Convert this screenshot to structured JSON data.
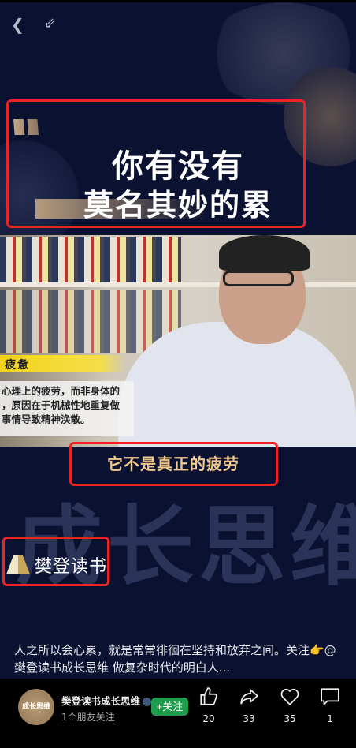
{
  "title_card": {
    "line1": "你有没有",
    "line2": "莫名其妙的累"
  },
  "video": {
    "banner": "疲惫",
    "info_lines": [
      "心理上的疲劳，而非身体的",
      "，原因在于机械性地重复做",
      "事情导致精神涣散。"
    ],
    "subtitle": "它不是真正的疲劳",
    "watermark": "成长思维",
    "logo_text": "樊登读书"
  },
  "caption": "人之所以会心累，就是常常徘徊在坚持和放弃之间。关注👉@樊登读书成长思维 做复杂时代的明白人...",
  "author": {
    "name": "樊登读书成长思维",
    "avatar_text": "成长思维",
    "friends": "1个朋友关注",
    "follow_label": "+关注"
  },
  "actions": {
    "like": "20",
    "share": "33",
    "favorite": "35",
    "comment": "1"
  },
  "colors": {
    "highlight_box": "#ee2222",
    "follow": "#1f9c4c",
    "subtitle": "#f0c98f"
  }
}
